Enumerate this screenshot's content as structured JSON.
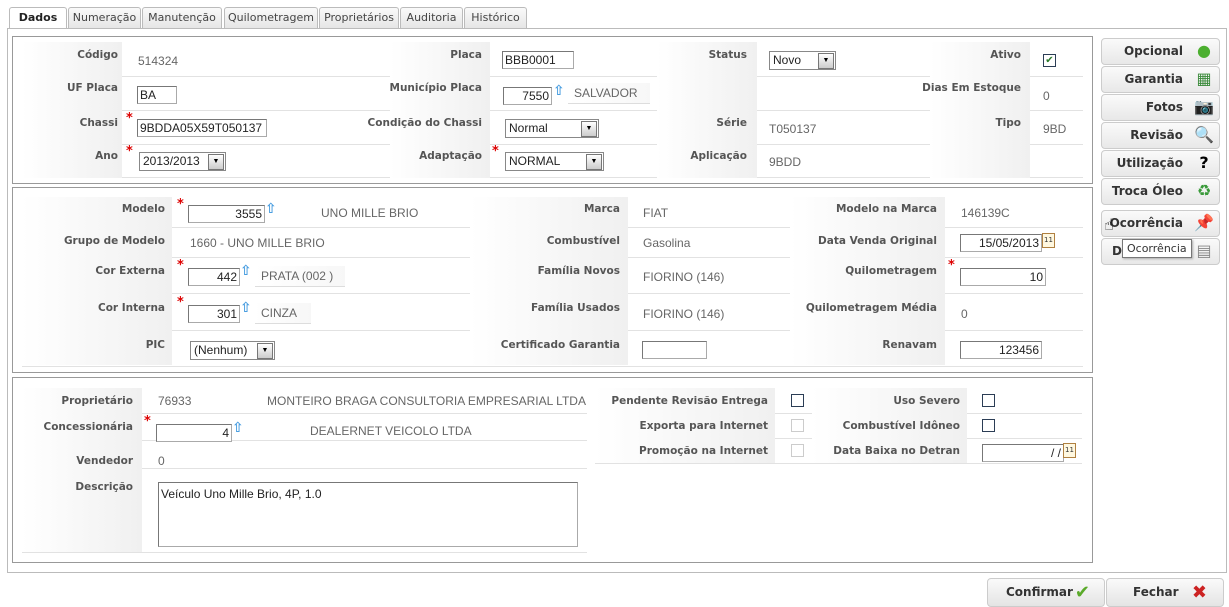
{
  "tabs": [
    "Dados",
    "Numeração",
    "Manutenção",
    "Quilometragem",
    "Proprietários",
    "Auditoria",
    "Histórico"
  ],
  "active_tab": "Dados",
  "s1": {
    "codigo_label": "Código",
    "codigo": "514324",
    "placa_label": "Placa",
    "placa": "BBB0001",
    "status_label": "Status",
    "status": "Novo",
    "ativo_label": "Ativo",
    "ativo": true,
    "uf_label": "UF Placa",
    "uf": "BA",
    "municipio_label": "Município Placa",
    "municipio_cod": "7550",
    "municipio": "SALVADOR",
    "dias_label": "Dias Em Estoque",
    "dias": "0",
    "chassi_label": "Chassi",
    "chassi": "9BDDA05X59T050137",
    "cond_label": "Condição do Chassi",
    "cond": "Normal",
    "serie_label": "Série",
    "serie": "T050137",
    "tipo_label": "Tipo",
    "tipo": "9BD",
    "ano_label": "Ano",
    "ano": "2013/2013",
    "adapt_label": "Adaptação",
    "adapt": "NORMAL",
    "aplic_label": "Aplicação",
    "aplic": "9BDD"
  },
  "s2": {
    "modelo_label": "Modelo",
    "modelo_cod": "3555",
    "modelo": "UNO MILLE BRIO",
    "marca_label": "Marca",
    "marca": "FIAT",
    "mm_label": "Modelo na Marca",
    "mm": "146139C",
    "grupo_label": "Grupo de Modelo",
    "grupo": "1660 - UNO MILLE BRIO",
    "comb_label": "Combustível",
    "comb": "Gasolina",
    "dvo_label": "Data Venda Original",
    "dvo": "15/05/2013",
    "corext_label": "Cor Externa",
    "corext_cod": "442",
    "corext": "PRATA (002 )",
    "fn_label": "Família Novos",
    "fn": "FIORINO (146)",
    "km_label": "Quilometragem",
    "km": "10",
    "corint_label": "Cor Interna",
    "corint_cod": "301",
    "corint": "CINZA",
    "fu_label": "Família Usados",
    "fu": "FIORINO (146)",
    "kmm_label": "Quilometragem Média",
    "kmm": "0",
    "pic_label": "PIC",
    "pic": "(Nenhum)",
    "cert_label": "Certificado Garantia",
    "cert": "",
    "renavam_label": "Renavam",
    "renavam": "123456"
  },
  "s3": {
    "prop_label": "Proprietário",
    "prop_cod": "76933",
    "prop": "MONTEIRO BRAGA CONSULTORIA EMPRESARIAL LTDA",
    "conc_label": "Concessionária",
    "conc_cod": "4",
    "conc": "DEALERNET VEICOLO LTDA",
    "vend_label": "Vendedor",
    "vend": "0",
    "desc_label": "Descrição",
    "desc": "Veículo Uno Mille Brio, 4P, 1.0",
    "pre_label": "Pendente Revisão Entrega",
    "pre": false,
    "uso_label": "Uso Severo",
    "uso": false,
    "exp_label": "Exporta para Internet",
    "exp": false,
    "ci_label": "Combustível Idôneo",
    "ci": false,
    "promo_label": "Promoção na Internet",
    "promo": false,
    "dbd_label": "Data Baixa no Detran",
    "dbd": " / /"
  },
  "side_buttons": [
    {
      "label": "Opcional",
      "icon": "plus-circle-icon"
    },
    {
      "label": "Garantia",
      "icon": "calendar-icon"
    },
    {
      "label": "Fotos",
      "icon": "camera-icon"
    },
    {
      "label": "Revisão",
      "icon": "magnifier-icon"
    },
    {
      "label": "Utilização",
      "icon": "person-question-icon"
    },
    {
      "label": "Troca Óleo",
      "icon": "recycle-icon"
    },
    {
      "label": "Ocorrência",
      "icon": "pushpin-icon"
    },
    {
      "label": "D",
      "icon": "document-icon"
    }
  ],
  "tooltip": "Ocorrência",
  "footer": {
    "confirm": "Confirmar",
    "close": "Fechar"
  },
  "colors": {
    "required": "#dd0000",
    "confirm_icon": "#5aaa2a",
    "close_icon": "#cc2222",
    "lookup_arrow": "#4a9ee0"
  }
}
